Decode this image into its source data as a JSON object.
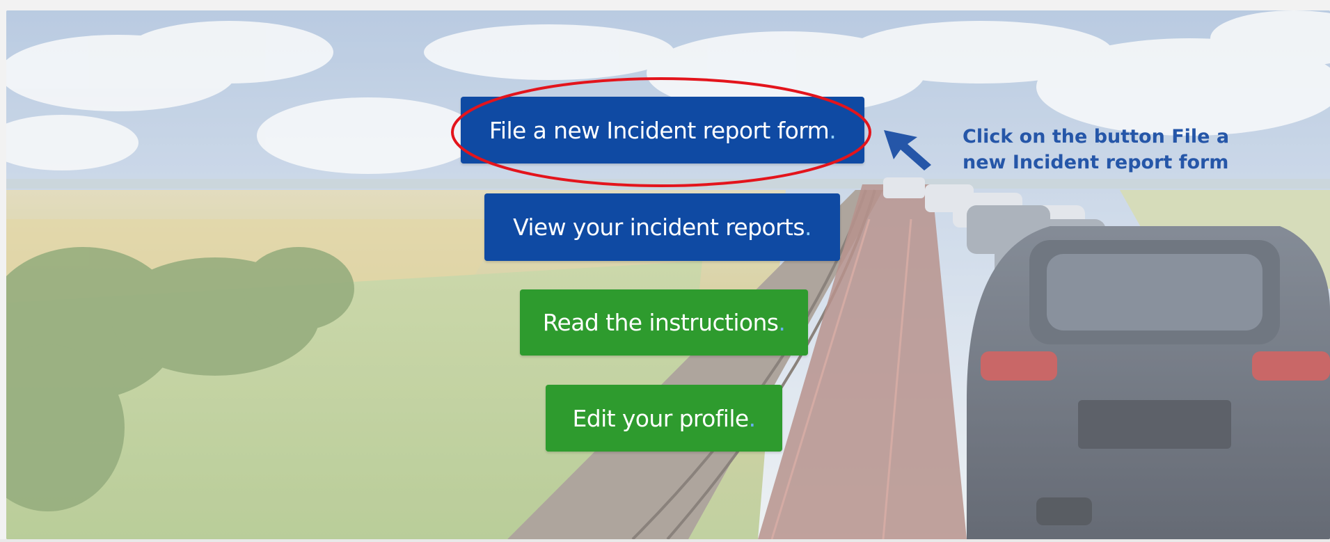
{
  "buttons": {
    "file_new": {
      "label": "File a new Incident report form",
      "dot": "."
    },
    "view_reports": {
      "label": "View your incident reports",
      "dot": "."
    },
    "read_instructions": {
      "label": "Read the instructions",
      "dot": "."
    },
    "edit_profile": {
      "label": "Edit your profile",
      "dot": "."
    }
  },
  "annotation": {
    "line1": "Click on the button File a",
    "line2": "new Incident report form",
    "highlight_color": "#e3141c",
    "arrow_color": "#2556a8"
  },
  "colors": {
    "primary_blue": "#0f4aa3",
    "primary_green": "#2e9b2e"
  },
  "hero": {
    "scene": "landscape-car-train-photo"
  }
}
